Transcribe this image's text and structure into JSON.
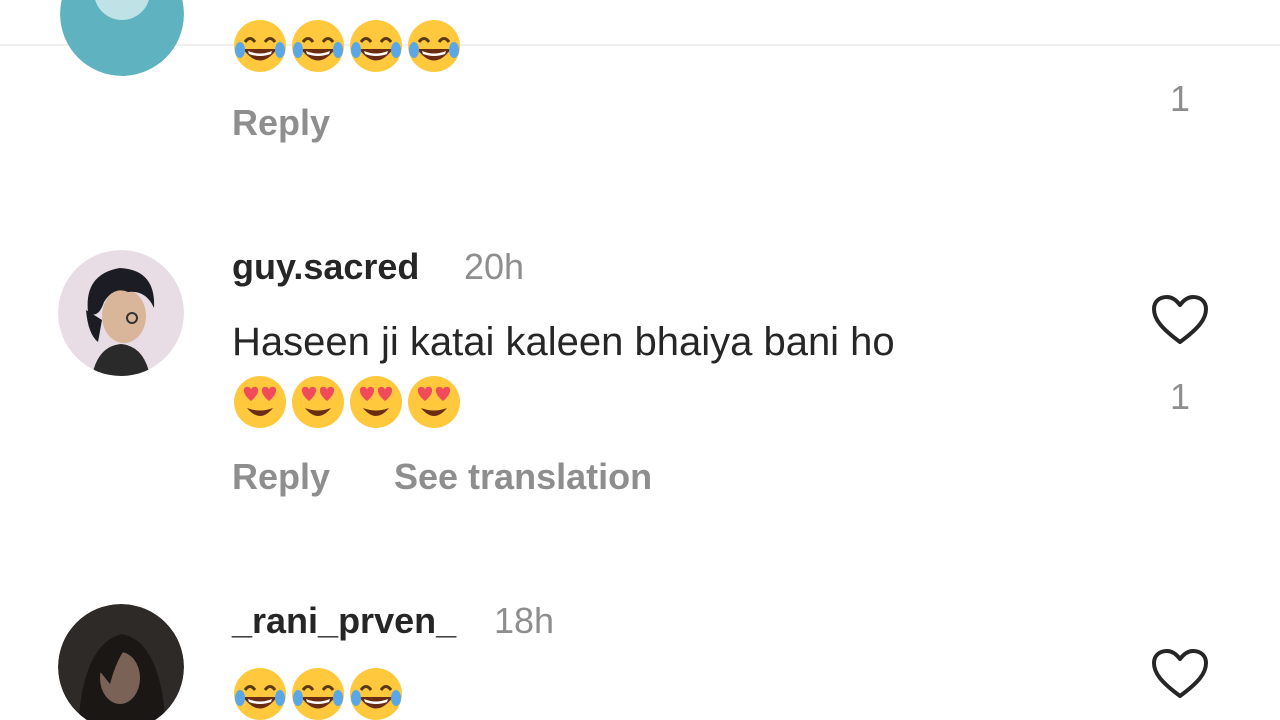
{
  "comments": [
    {
      "username": "",
      "time": "",
      "text": "",
      "emojis": [
        "tears-of-joy",
        "tears-of-joy",
        "tears-of-joy",
        "tears-of-joy"
      ],
      "actions": {
        "reply": "Reply"
      },
      "likes": "1"
    },
    {
      "username": "guy.sacred",
      "time": "20h",
      "text": "Haseen ji katai kaleen bhaiya bani ho",
      "emojis": [
        "heart-eyes",
        "heart-eyes",
        "heart-eyes",
        "heart-eyes"
      ],
      "actions": {
        "reply": "Reply",
        "translate": "See translation"
      },
      "likes": "1"
    },
    {
      "username": "_rani_prven_",
      "time": "18h",
      "text": "",
      "emojis": [
        "tears-of-joy",
        "tears-of-joy",
        "tears-of-joy"
      ],
      "actions": {},
      "likes": ""
    }
  ],
  "colors": {
    "primary_text": "#262626",
    "secondary_text": "#8e8e8e",
    "emoji_face": "#ffc83d",
    "heart_eyes": "#f04a5b",
    "tears": "#5aa7e8"
  }
}
